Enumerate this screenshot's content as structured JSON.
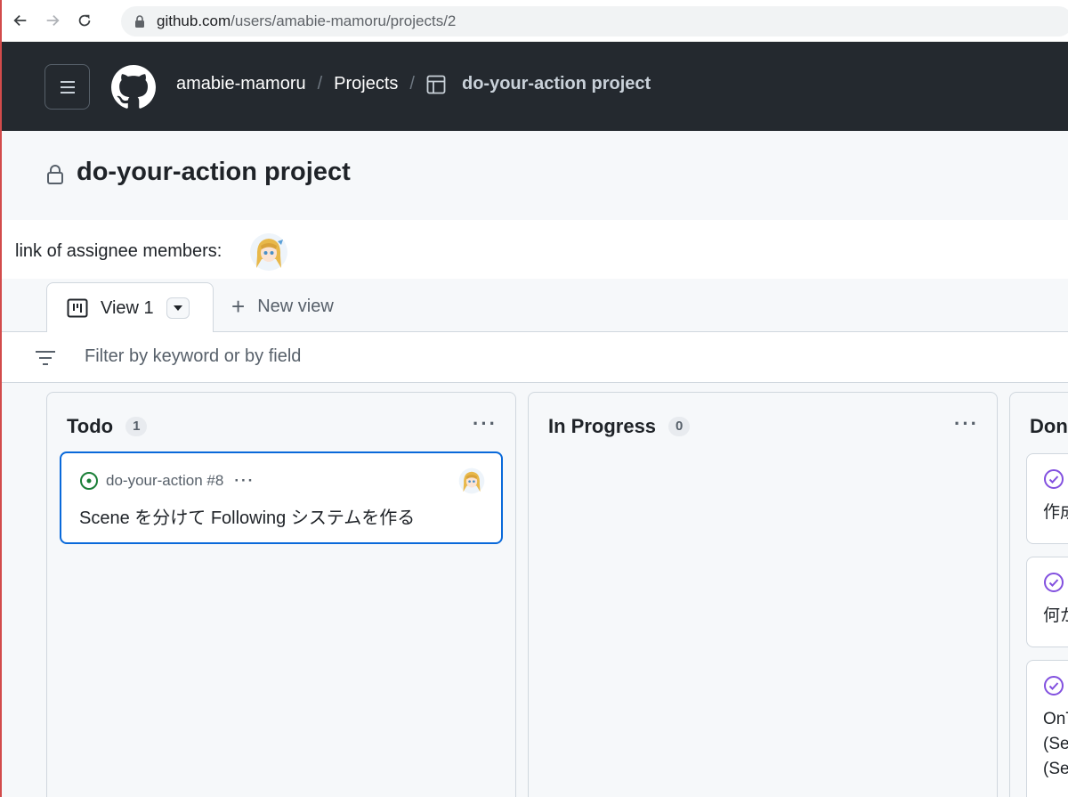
{
  "browser": {
    "url_host": "github.com",
    "url_path": "/users/amabie-mamoru/projects/2"
  },
  "header": {
    "breadcrumb_user": "amabie-mamoru",
    "breadcrumb_projects": "Projects",
    "breadcrumb_project": "do-your-action project",
    "separator": "/"
  },
  "project": {
    "title": "do-your-action project",
    "description": "link of assignee members:"
  },
  "tabs": {
    "active_label": "View 1",
    "new_view_label": "New view"
  },
  "filter": {
    "placeholder": "Filter by keyword or by field"
  },
  "columns": [
    {
      "name": "Todo",
      "count": "1",
      "cards": [
        {
          "ref": "do-your-action #8",
          "title": "Scene を分けて Following システムを作る"
        }
      ]
    },
    {
      "name": "In Progress",
      "count": "0",
      "cards": []
    },
    {
      "name": "Don",
      "cards": [
        {
          "text_lines": [
            "作成"
          ]
        },
        {
          "text_lines": [
            "何か"
          ]
        },
        {
          "text_lines": [
            "OnT",
            "(Se",
            "(Se"
          ]
        }
      ]
    }
  ],
  "colors": {
    "header_bg": "#24292f",
    "accent_blue": "#0969da",
    "open_green": "#1a7f37",
    "done_purple": "#8250df"
  },
  "icons": {
    "menu": "hamburger-icon",
    "logo": "github-logo",
    "table": "table-icon",
    "board": "board-icon",
    "filter": "filter-icon",
    "issue_open": "issue-open-icon",
    "issue_closed": "issue-closed-icon"
  }
}
